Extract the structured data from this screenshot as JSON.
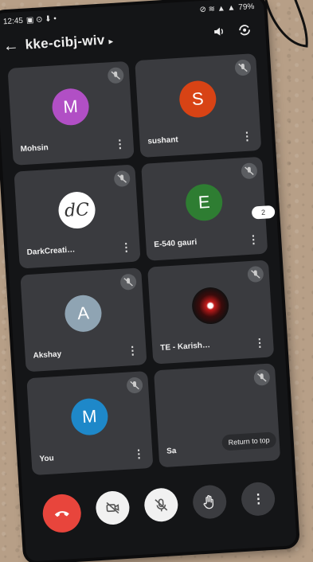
{
  "status_bar": {
    "time": "12:45",
    "battery": "79%"
  },
  "header": {
    "meeting_code": "kke-cibj-wiv",
    "icons": [
      "back-arrow-icon",
      "speaker-icon",
      "switch-camera-icon"
    ]
  },
  "participants": [
    {
      "name": "Mohsin",
      "initial": "M",
      "color": "#b14fc5",
      "muted": true
    },
    {
      "name": "sushant",
      "initial": "S",
      "color": "#d84315",
      "muted": true
    },
    {
      "name": "DarkCreati…",
      "initial": "dC",
      "color": "#ffffff",
      "muted": true
    },
    {
      "name": "E-540 gauri",
      "initial": "E",
      "color": "#2e7d32",
      "muted": true
    },
    {
      "name": "Akshay",
      "initial": "A",
      "color": "#8fa4b3",
      "muted": true
    },
    {
      "name": "TE - Karish…",
      "initial": "",
      "color": "#111111",
      "muted": true
    },
    {
      "name": "You",
      "initial": "M",
      "color": "#1e88c9",
      "muted": true
    },
    {
      "name": "Sa",
      "initial": "",
      "color": "",
      "muted": true
    }
  ],
  "overflow_badge": "2",
  "return_to_top": "Return to top",
  "controls": {
    "end_call": "end-call-icon",
    "camera_off": "camera-off-icon",
    "mic_off": "mic-off-icon",
    "raise_hand": "raise-hand-icon",
    "more": "more-options-icon"
  }
}
